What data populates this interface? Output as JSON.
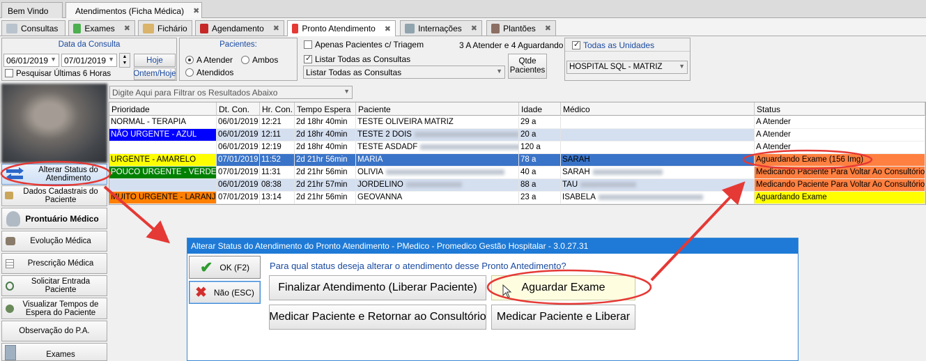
{
  "main_tabs": [
    {
      "label": "Bem Vindo"
    },
    {
      "label": "Atendimentos (Ficha Médica)"
    }
  ],
  "sub_tabs": [
    {
      "label": "Consultas"
    },
    {
      "label": "Exames"
    },
    {
      "label": "Fichário"
    },
    {
      "label": "Agendamento"
    },
    {
      "label": "Pronto Atendimento"
    },
    {
      "label": "Internações"
    },
    {
      "label": "Plantões"
    }
  ],
  "tab_close": "✖",
  "filters": {
    "date_group_title": "Data da Consulta",
    "date_from": "06/01/2019",
    "date_to": "07/01/2019",
    "today_label": "Hoje",
    "yesterday_today_label": "Ontem/Hoje",
    "last6h_label": "Pesquisar Últimas 6 Horas",
    "patients_title": "Pacientes:",
    "radio_a_atender": "A Atender",
    "radio_ambos": "Ambos",
    "radio_atendidos": "Atendidos",
    "triage_label": "Apenas Pacientes c/ Triagem",
    "list_all_label": "Listar Todas as Consultas",
    "list_combo_value": "Listar Todas as Consultas",
    "counter_text": "3 A Atender e 4 Aguardando",
    "qtde_label_1": "Qtde",
    "qtde_label_2": "Pacientes",
    "units_label": "Todas as Unidades",
    "unit_value": "HOSPITAL SQL - MATRIZ"
  },
  "filter_input": {
    "placeholder": "Digite Aqui para Filtrar os Resultados Abaixo"
  },
  "sidebar": {
    "items": [
      {
        "label": "Alterar Status do Atendimento"
      },
      {
        "label": "Dados Cadastrais do Paciente"
      },
      {
        "label": "Prontuário Médico"
      },
      {
        "label": "Evolução Médica"
      },
      {
        "label": "Prescrição Médica"
      },
      {
        "label": "Solicitar Entrada Paciente"
      },
      {
        "label": "Visualizar Tempos de Espera do Paciente"
      },
      {
        "label": "Observação do P.A."
      },
      {
        "label": "Exames"
      }
    ]
  },
  "table": {
    "columns": [
      "Prioridade",
      "Dt. Con.",
      "Hr. Con.",
      "Tempo Espera",
      "Paciente",
      "Idade",
      "Médico",
      "Status"
    ],
    "rows": [
      {
        "prioridade": "NORMAL - TERAPIA",
        "dt": "06/01/2019",
        "hr": "12:21",
        "espera": "2d 18hr 40min",
        "paciente": "TESTE OLIVEIRA MATRIZ",
        "idade": "29 a",
        "medico": "",
        "status": "A Atender",
        "prio_bg": "#ffffff",
        "prio_fg": "#000000",
        "status_bg": "#ffffff",
        "row_bg": "#ffffff"
      },
      {
        "prioridade": "NÃO URGENTE - AZUL",
        "dt": "06/01/2019",
        "hr": "12:11",
        "espera": "2d 18hr 40min",
        "paciente": "TESTE 2 DOIS",
        "idade": "20 a",
        "medico": "",
        "status": "A Atender",
        "prio_bg": "#0000ff",
        "prio_fg": "#ffffff",
        "status_bg": "#ffffff",
        "row_bg": "#d4dff0"
      },
      {
        "prioridade": "",
        "dt": "06/01/2019",
        "hr": "12:19",
        "espera": "2d 18hr 40min",
        "paciente": "TESTE ASDADF",
        "idade": "120 a",
        "medico": "",
        "status": "A Atender",
        "prio_bg": "#ffffff",
        "prio_fg": "#000000",
        "status_bg": "#ffffff",
        "row_bg": "#ffffff"
      },
      {
        "prioridade": "URGENTE - AMARELO",
        "dt": "07/01/2019",
        "hr": "11:52",
        "espera": "2d 21hr 56min",
        "paciente": "MARIA",
        "idade": "78 a",
        "medico": "SARAH",
        "status": "Aguardando Exame (156 Img)",
        "prio_bg": "#ffff00",
        "prio_fg": "#000000",
        "status_bg": "#ff8040",
        "row_bg": "#3a74c8",
        "selected": true
      },
      {
        "prioridade": "POUCO URGENTE - VERDE",
        "dt": "07/01/2019",
        "hr": "11:31",
        "espera": "2d 21hr 56min",
        "paciente": "OLIVIA",
        "idade": "40 a",
        "medico": "SARAH",
        "status": "Medicando Paciente Para Voltar Ao Consultório",
        "prio_bg": "#008000",
        "prio_fg": "#ffffff",
        "status_bg": "#ff8040",
        "row_bg": "#ffffff"
      },
      {
        "prioridade": "",
        "dt": "06/01/2019",
        "hr": "08:38",
        "espera": "2d 21hr 57min",
        "paciente": "JORDELINO",
        "idade": "88 a",
        "medico": "TAU",
        "status": "Medicando Paciente Para Voltar Ao Consultório",
        "prio_bg": "#d4dff0",
        "prio_fg": "#000000",
        "status_bg": "#ff8040",
        "row_bg": "#d4dff0"
      },
      {
        "prioridade": "MUITO URGENTE - LARANJA",
        "dt": "07/01/2019",
        "hr": "13:14",
        "espera": "2d 21hr 56min",
        "paciente": "GEOVANNA",
        "idade": "23 a",
        "medico": "ISABELA",
        "status": "Aguardando Exame",
        "prio_bg": "#ff8000",
        "prio_fg": "#000000",
        "status_bg": "#ffff00",
        "row_bg": "#ffffff"
      }
    ]
  },
  "dialog": {
    "title": "Alterar Status do Atendimento do Pronto Atendimento - PMedico - Promedico Gestão Hospitalar - 3.0.27.31",
    "question": "Para qual status deseja alterar o atendimento desse Pronto Antedimento?",
    "ok_label": "OK (F2)",
    "cancel_label": "Não (ESC)",
    "options": [
      "Finalizar Atendimento (Liberar Paciente)",
      "Aguardar Exame",
      "Medicar Paciente e Retornar ao Consultório",
      "Medicar Paciente e Liberar"
    ]
  },
  "colors": {
    "accent": "#1e7ad6",
    "highlight": "#e53935",
    "selected_row": "#3a74c8"
  }
}
